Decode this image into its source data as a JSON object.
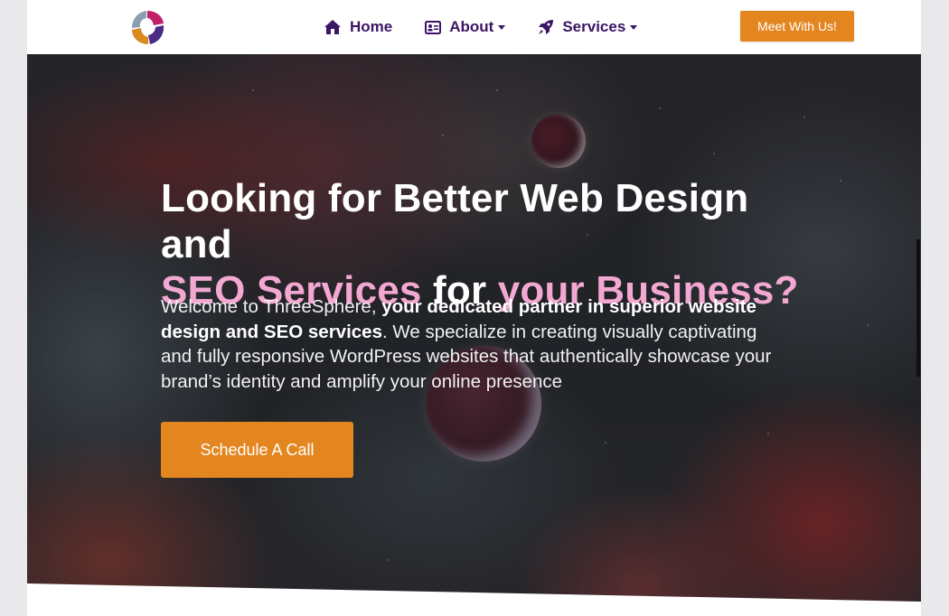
{
  "header": {
    "nav": [
      {
        "label": "Home",
        "icon": "home-icon"
      },
      {
        "label": "About",
        "icon": "id-card-icon",
        "dropdown": true
      },
      {
        "label": "Services",
        "icon": "rocket-icon",
        "dropdown": true
      }
    ],
    "cta_label": "Meet With Us!"
  },
  "hero": {
    "headline_white": "Looking for Better Web Design and",
    "headline_pink_lead": "SEO Services ",
    "headline_white_2": "for ",
    "headline_pink": "your Business?",
    "intro_prefix": "Welcome to ThreeSphere, ",
    "intro_bold": "your dedicated partner in superior website design and SEO services",
    "intro_suffix": ". We specialize in creating visually captivating and fully responsive WordPress websites that authentically showcase your brand’s identity and amplify your online presence",
    "button_label": "Schedule A Call"
  },
  "colors": {
    "brand_purple": "#3b1566",
    "accent_orange": "#e3861f",
    "headline_pink": "#f3a8d2"
  }
}
